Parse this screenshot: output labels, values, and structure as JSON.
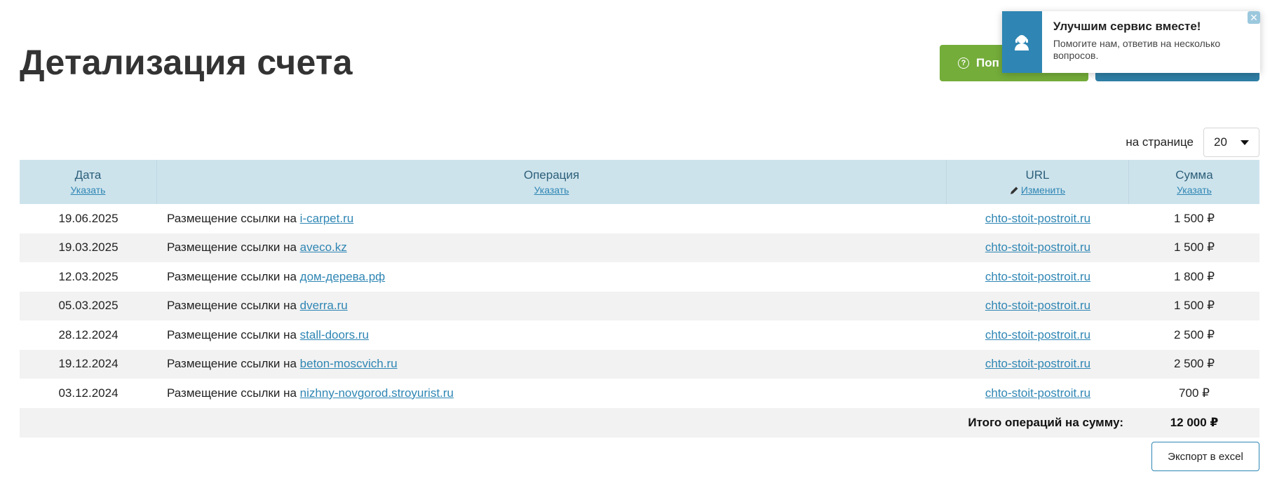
{
  "page": {
    "title": "Детализация счета"
  },
  "header": {
    "help_button_label": "Поп",
    "help_icon": "question-circle-icon"
  },
  "popup": {
    "title": "Улучшим сервис вместе!",
    "text": "Помогите нам, ответив на несколько вопросов.",
    "icon": "support-agent-icon",
    "close_label": "✕"
  },
  "pagination": {
    "per_page_label": "на странице",
    "per_page_value": "20"
  },
  "table": {
    "columns": [
      {
        "title": "Дата",
        "link": "Указать"
      },
      {
        "title": "Операция",
        "link": "Указать"
      },
      {
        "title": "URL",
        "link": "Изменить"
      },
      {
        "title": "Сумма",
        "link": "Указать"
      }
    ],
    "rows": [
      {
        "date": "19.06.2025",
        "op_prefix": "Размещение ссылки на",
        "op_link": "i-carpet.ru",
        "url": "chto-stoit-postroit.ru",
        "sum": "1 500 ₽"
      },
      {
        "date": "19.03.2025",
        "op_prefix": "Размещение ссылки на",
        "op_link": "aveco.kz",
        "url": "chto-stoit-postroit.ru",
        "sum": "1 500 ₽"
      },
      {
        "date": "12.03.2025",
        "op_prefix": "Размещение ссылки на",
        "op_link": "дом-дерева.рф",
        "url": "chto-stoit-postroit.ru",
        "sum": "1 800 ₽"
      },
      {
        "date": "05.03.2025",
        "op_prefix": "Размещение ссылки на",
        "op_link": "dverra.ru",
        "url": "chto-stoit-postroit.ru",
        "sum": "1 500 ₽"
      },
      {
        "date": "28.12.2024",
        "op_prefix": "Размещение ссылки на",
        "op_link": "stall-doors.ru",
        "url": "chto-stoit-postroit.ru",
        "sum": "2 500 ₽"
      },
      {
        "date": "19.12.2024",
        "op_prefix": "Размещение ссылки на",
        "op_link": "beton-moscvich.ru",
        "url": "chto-stoit-postroit.ru",
        "sum": "2 500 ₽"
      },
      {
        "date": "03.12.2024",
        "op_prefix": "Размещение ссылки на",
        "op_link": "nizhny-novgorod.stroyurist.ru",
        "url": "chto-stoit-postroit.ru",
        "sum": "700 ₽"
      }
    ],
    "total_label": "Итого операций на сумму:",
    "total_sum": "12 000 ₽"
  },
  "export": {
    "label": "Экспорт в excel"
  }
}
